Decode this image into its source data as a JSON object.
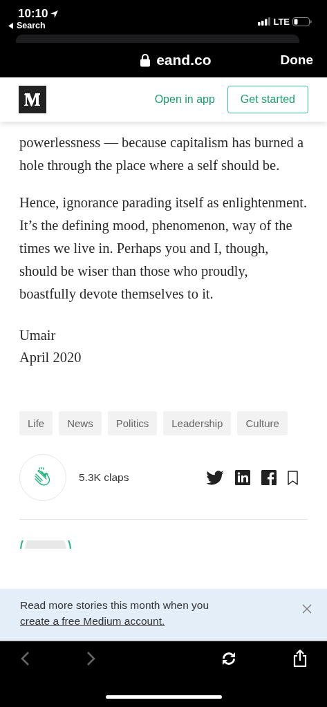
{
  "status_bar": {
    "time": "10:10",
    "back_label": "Search",
    "network": "LTE"
  },
  "browser": {
    "domain": "eand.co",
    "done": "Done"
  },
  "site_header": {
    "open_in_app": "Open in app",
    "get_started": "Get started"
  },
  "article": {
    "paragraphs": [
      "powerlessness — because capitalism has burned a hole through the place where a self should be.",
      "Hence, ignorance parading itself as enlightenment. It’s the defining mood, phenomenon, way of the times we live in. Perhaps you and I, though, should be wiser than those who proudly, boastfully devote themselves to it."
    ],
    "signature": [
      "Umair",
      "April 2020"
    ]
  },
  "tags": [
    "Life",
    "News",
    "Politics",
    "Leadership",
    "Culture"
  ],
  "claps": "5.3K claps",
  "banner": {
    "text": "Read more stories this month when you",
    "link": "create a free Medium account."
  },
  "toolbar": [
    {
      "kind": "back",
      "disabled": true
    },
    {
      "kind": "forward",
      "disabled": true
    },
    {
      "kind": "reload",
      "disabled": false
    },
    {
      "kind": "share",
      "disabled": false
    }
  ]
}
